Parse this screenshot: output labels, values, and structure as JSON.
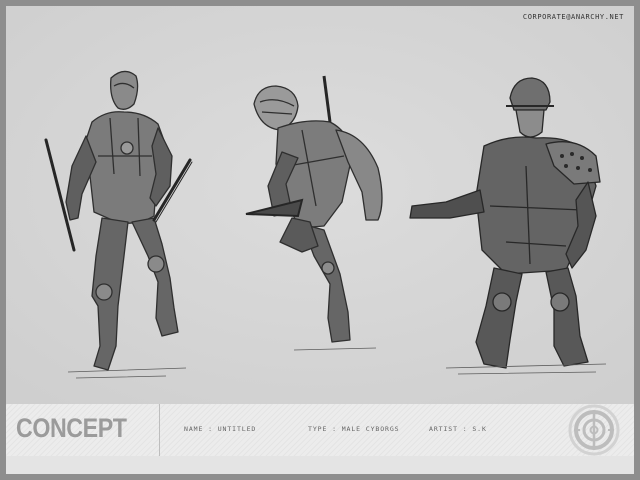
{
  "header": {
    "site_url": "CORPORATE@ANARCHY.NET"
  },
  "artwork": {
    "subject": "three male cyborg soldier pencil sketches",
    "figures": [
      "cyborg-left",
      "cyborg-middle",
      "cyborg-right"
    ]
  },
  "footer": {
    "title": "CONCEPT",
    "name_field": "NAME : UNTITLED",
    "type_field": "TYPE : MALE CYBORGS",
    "artist_field": "ARTIST : S.K"
  },
  "colors": {
    "sheet": "#d7d7d7",
    "frame": "#8e8e8e",
    "footer": "#ececec",
    "sketch": "#3a3a3a",
    "title": "#9b9b9b"
  },
  "icons": {
    "logo": "target-circle-logo-icon"
  }
}
